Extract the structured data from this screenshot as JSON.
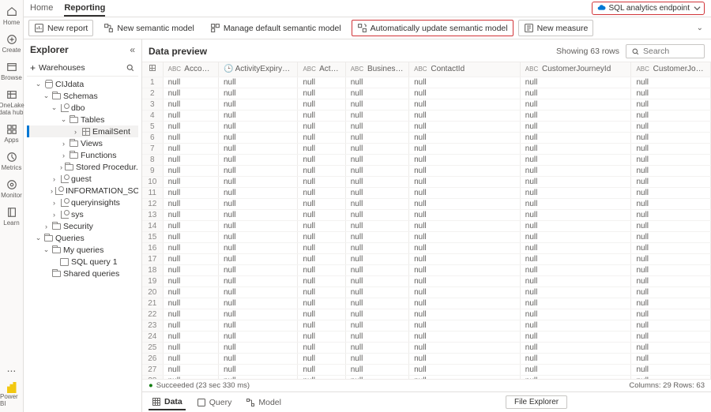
{
  "leftrail": [
    {
      "name": "home",
      "label": "Home"
    },
    {
      "name": "create",
      "label": "Create"
    },
    {
      "name": "browse",
      "label": "Browse"
    },
    {
      "name": "onelake",
      "label": "OneLake data hub"
    },
    {
      "name": "apps",
      "label": "Apps"
    },
    {
      "name": "metrics",
      "label": "Metrics"
    },
    {
      "name": "monitor",
      "label": "Monitor"
    },
    {
      "name": "learn",
      "label": "Learn"
    }
  ],
  "leftrail_more": "...",
  "leftrail_pbi": "Power BI",
  "top_tabs": {
    "home": "Home",
    "reporting": "Reporting"
  },
  "endpoint": "SQL analytics endpoint",
  "toolbar": {
    "new_report": "New report",
    "new_semantic": "New semantic model",
    "manage_default": "Manage default semantic model",
    "auto_update": "Automatically update semantic model",
    "new_measure": "New measure"
  },
  "explorer": {
    "title": "Explorer",
    "warehouses": "Warehouses",
    "nodes": {
      "cijdata": "CIJdata",
      "schemas": "Schemas",
      "dbo": "dbo",
      "tables": "Tables",
      "emailsent": "EmailSent",
      "views": "Views",
      "functions": "Functions",
      "sprocs": "Stored Procedur...",
      "guest": "guest",
      "infoschema": "INFORMATION_SCHE...",
      "queryinsights": "queryinsights",
      "sys": "sys",
      "security": "Security",
      "queries": "Queries",
      "myqueries": "My queries",
      "sqlquery1": "SQL query 1",
      "sharedqueries": "Shared queries"
    }
  },
  "preview": {
    "title": "Data preview",
    "showing": "Showing 63 rows",
    "search_ph": "Search",
    "columns": [
      {
        "type": "ABC",
        "name": "AccountId"
      },
      {
        "type": "clock",
        "name": "ActivityExpiryTime"
      },
      {
        "type": "ABC",
        "name": "ActivityId"
      },
      {
        "type": "ABC",
        "name": "BusinessUnitId"
      },
      {
        "type": "ABC",
        "name": "ContactId"
      },
      {
        "type": "ABC",
        "name": "CustomerJourneyId"
      },
      {
        "type": "ABC",
        "name": "CustomerJourney"
      }
    ],
    "cell": "null",
    "row_count": 28
  },
  "status": {
    "text": "Succeeded (23 sec 330 ms)",
    "right": "Columns: 29  Rows: 63"
  },
  "footer": {
    "data": "Data",
    "query": "Query",
    "model": "Model",
    "file_explorer": "File Explorer"
  }
}
